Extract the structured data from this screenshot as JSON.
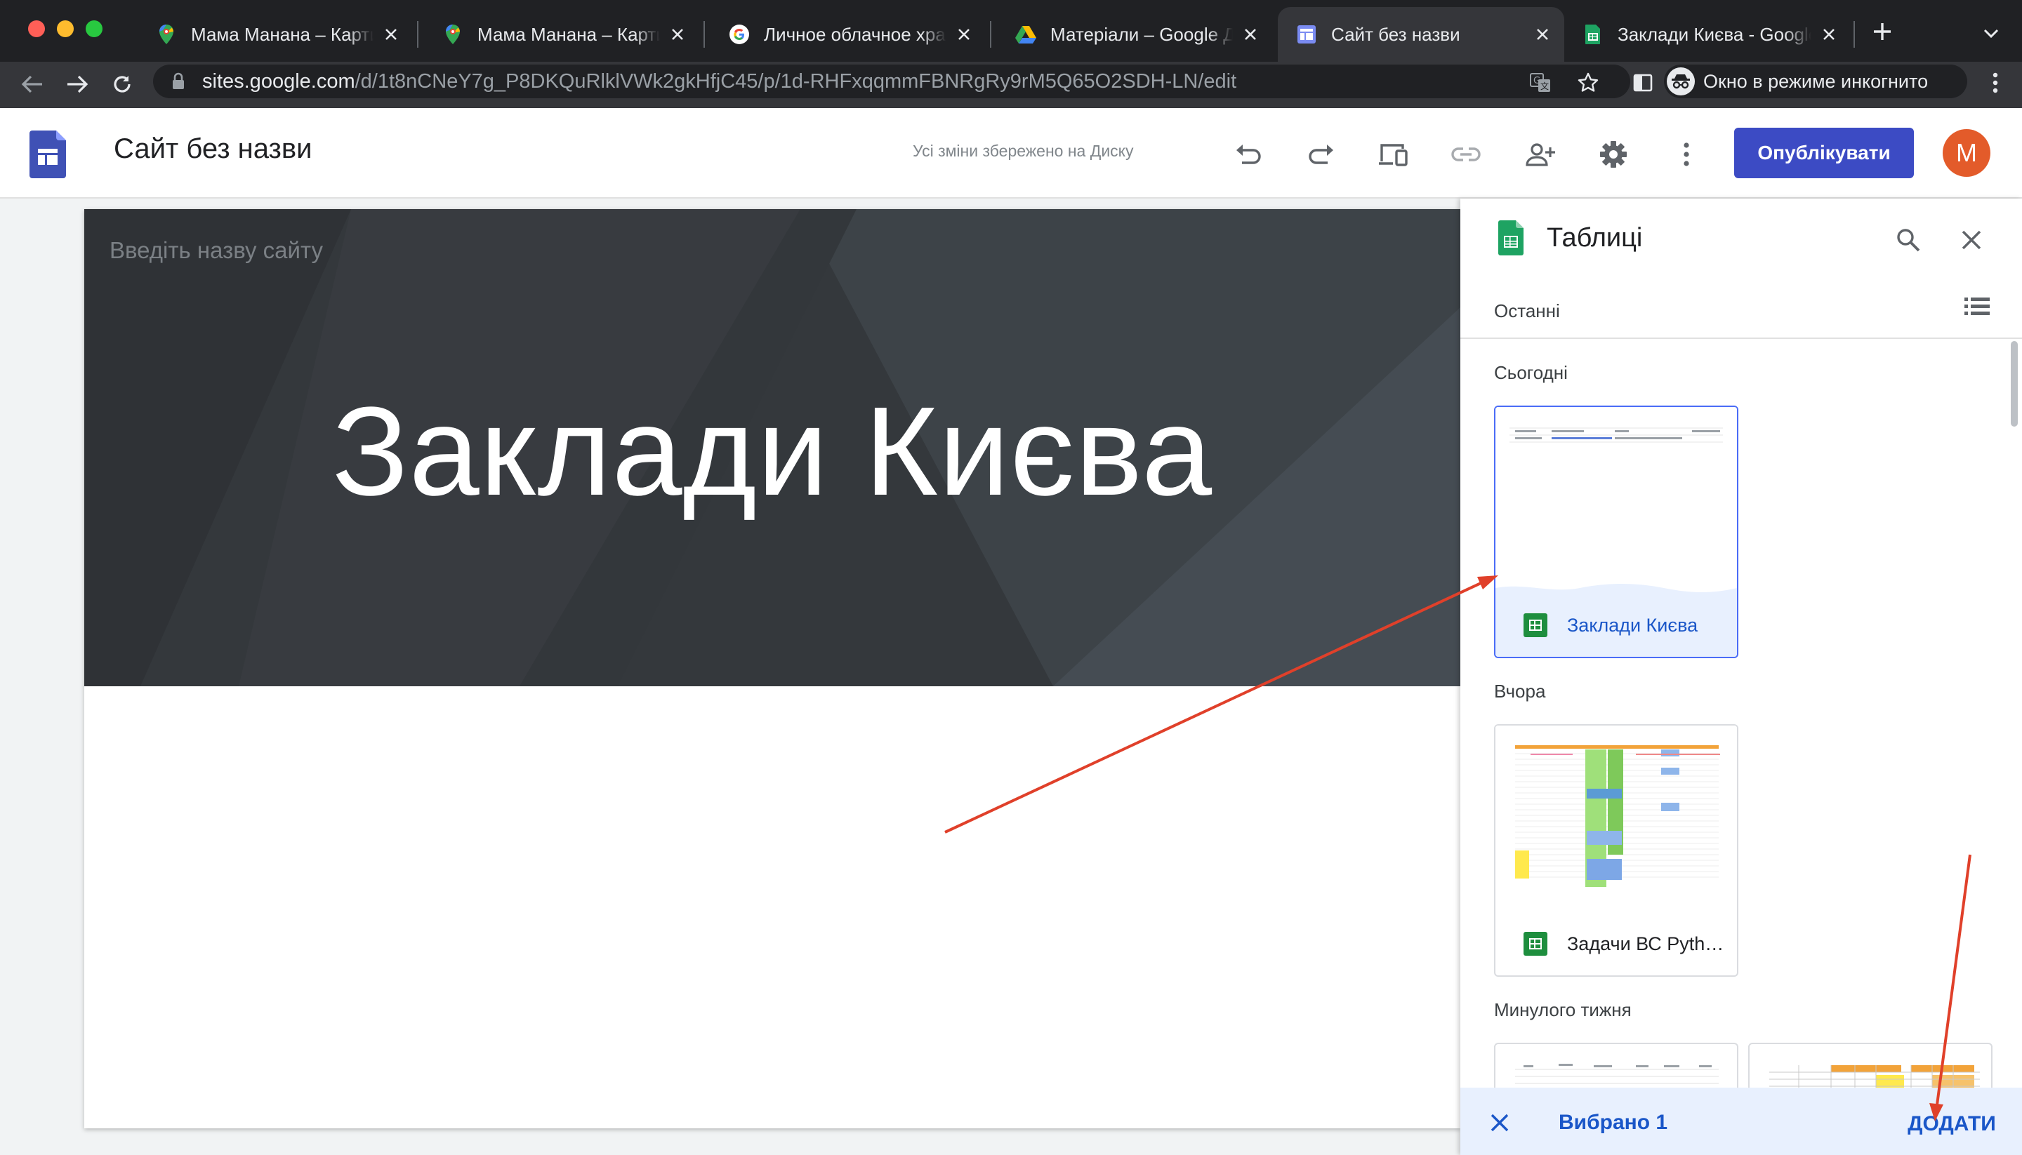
{
  "browser": {
    "tabs": [
      {
        "title": "Мама Манана – Карти Google",
        "icon": "google-maps-icon",
        "active": false
      },
      {
        "title": "Мама Манана – Карти Google",
        "icon": "google-maps-icon",
        "active": false
      },
      {
        "title": "Личное облачное хранилище",
        "icon": "google-g-icon",
        "active": false
      },
      {
        "title": "Матеріали – Google Диск",
        "icon": "google-drive-icon",
        "active": false
      },
      {
        "title": "Сайт без назви",
        "icon": "google-sites-icon",
        "active": true
      },
      {
        "title": "Заклади Києва - Google Таблиці",
        "icon": "google-sheets-icon",
        "active": false
      }
    ],
    "url_host": "sites.google.com",
    "url_path": "/d/1t8nCNeY7g_P8DKQuRlklVWk2gkHfjC45/p/1d-RHFxqqmmFBNRgRy9rM5Q65O2SDH-LN/edit",
    "incognito_label": "Окно в режиме инкогнито"
  },
  "header": {
    "site_name": "Сайт без назви",
    "save_status": "Усі зміни збережено на Диску",
    "publish_label": "Опублікувати",
    "avatar_letter": "M"
  },
  "canvas": {
    "site_title_placeholder": "Введіть назву сайту",
    "hero_title": "Заклади Києва"
  },
  "panel": {
    "title": "Таблиці",
    "filter_label": "Останні",
    "sections": {
      "today": "Сьогодні",
      "yesterday": "Вчора",
      "last_week": "Минулого тижня"
    },
    "files": {
      "today": "Заклади Києва",
      "yesterday": "Задачи ВС Pyth…"
    },
    "selected_label": "Вибрано 1",
    "add_label": "ДОДАТИ"
  },
  "colors": {
    "accent": "#3c4bc4",
    "link_blue": "#1a56c8",
    "selection_bg": "#e8f0fe",
    "avatar": "#e35b2a",
    "sheets_green": "#1e8e3e",
    "annotation_arrow": "#e0402a"
  }
}
